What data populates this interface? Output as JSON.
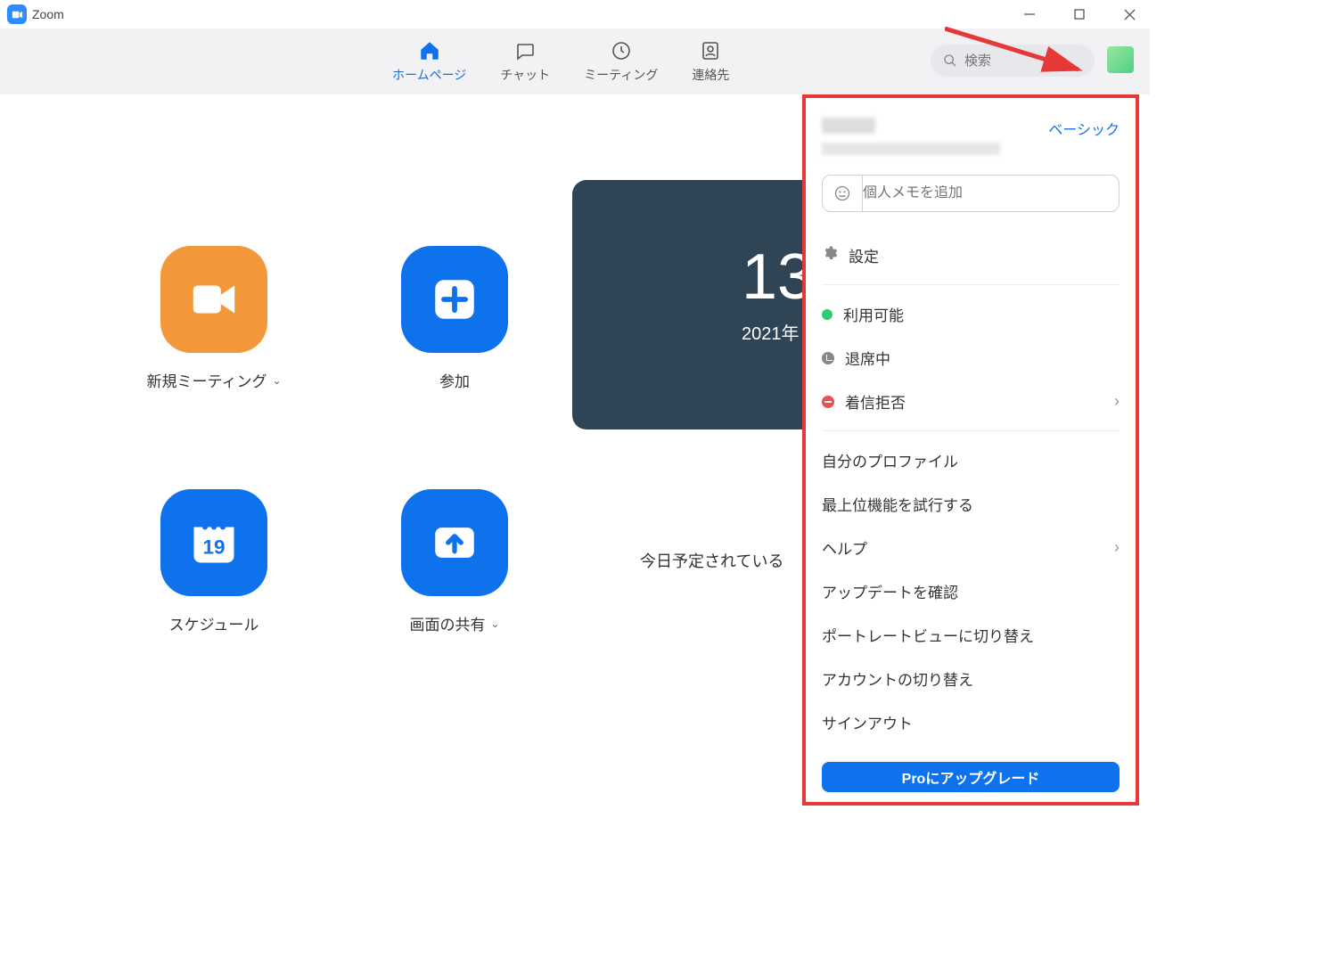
{
  "titlebar": {
    "app_name": "Zoom"
  },
  "tabs": {
    "home": {
      "label": "ホームページ"
    },
    "chat": {
      "label": "チャット"
    },
    "meeting": {
      "label": "ミーティング"
    },
    "contacts": {
      "label": "連絡先"
    }
  },
  "search": {
    "placeholder": "検索"
  },
  "actions": {
    "new_meeting": {
      "label": "新規ミーティング"
    },
    "join": {
      "label": "参加"
    },
    "schedule": {
      "label": "スケジュール",
      "calendar_day": "19"
    },
    "share": {
      "label": "画面の共有"
    }
  },
  "clock": {
    "time_partial": "13",
    "date_partial": "2021年",
    "no_meeting_partial": "今日予定されている"
  },
  "profile_menu": {
    "plan_label": "ベーシック",
    "personal_note_placeholder": "個人メモを追加",
    "settings": "設定",
    "status_available": "利用可能",
    "status_away": "退席中",
    "status_dnd": "着信拒否",
    "my_profile": "自分のプロファイル",
    "try_top": "最上位機能を試行する",
    "help": "ヘルプ",
    "check_updates": "アップデートを確認",
    "switch_portrait": "ポートレートビューに切り替え",
    "switch_account": "アカウントの切り替え",
    "signout": "サインアウト",
    "upgrade": "Proにアップグレード"
  }
}
